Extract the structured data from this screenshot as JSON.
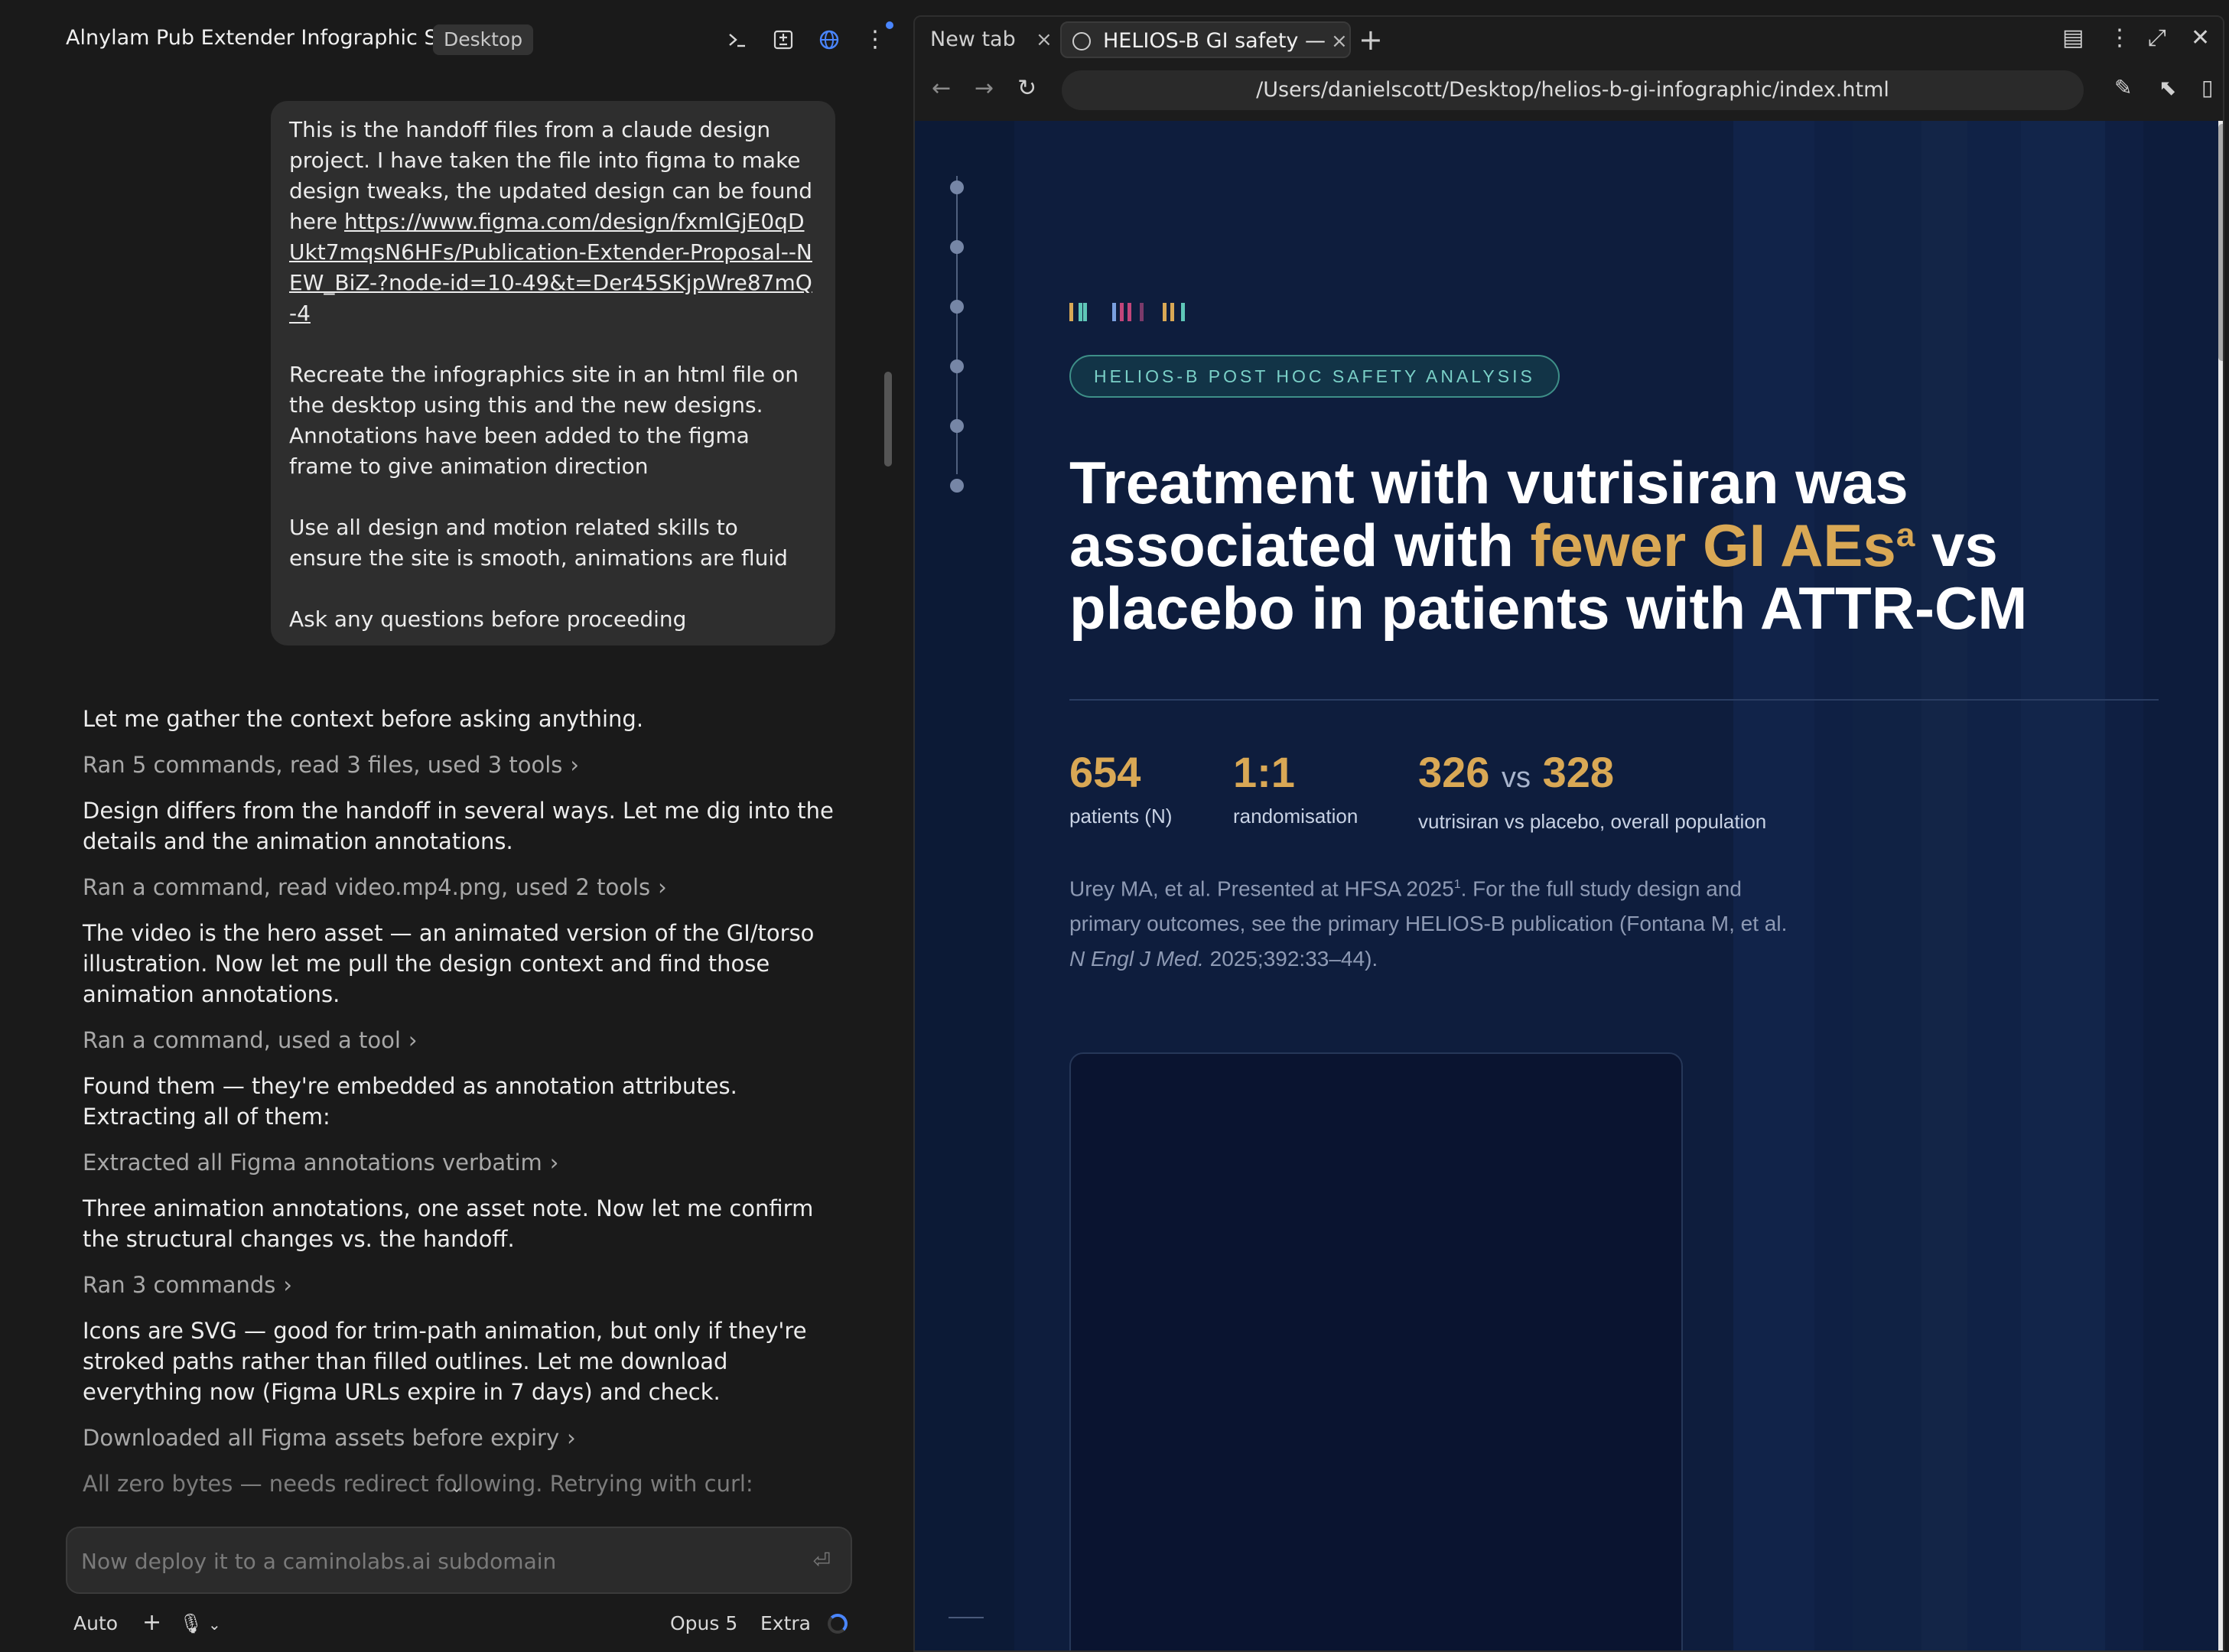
{
  "chat": {
    "title": "Alnylam Pub Extender Infographic Site",
    "badge": "Desktop",
    "user_message": {
      "p1": "This is the handoff files from a claude design project. I have taken the file into figma to make design tweaks, the updated design can be found here",
      "link": "https://www.figma.com/design/fxmlGjE0qDUkt7mqsN6HFs/Publication-Extender-Proposal--NEW_BiZ-?node-id=10-49&t=Der45SKjpWre87mQ-4",
      "p2": "Recreate the infographics site in an html file on the desktop using this and the new designs. Annotations have been added to the figma frame to give animation direction",
      "p3": "Use all design and motion related skills to ensure the site is smooth, animations are fluid",
      "p4": "Ask any questions before proceeding"
    },
    "transcript": [
      {
        "kind": "text",
        "text": "Let me gather the context before asking anything."
      },
      {
        "kind": "tool",
        "text": "Ran 5 commands, read 3 files, used 3 tools"
      },
      {
        "kind": "text",
        "text": "Design differs from the handoff in several ways. Let me dig into the details and the animation annotations."
      },
      {
        "kind": "tool",
        "text": "Ran a command, read video.mp4.png, used 2 tools"
      },
      {
        "kind": "text",
        "text": "The video is the hero asset — an animated version of the GI/torso illustration. Now let me pull the design context and find those animation annotations."
      },
      {
        "kind": "tool",
        "text": "Ran a command, used a tool"
      },
      {
        "kind": "text",
        "text": "Found them — they're embedded as annotation attributes. Extracting all of them:"
      },
      {
        "kind": "tool",
        "text": "Extracted all Figma annotations verbatim"
      },
      {
        "kind": "text",
        "text": "Three animation annotations, one asset note. Now let me confirm the structural changes vs. the handoff."
      },
      {
        "kind": "tool",
        "text": "Ran 3 commands"
      },
      {
        "kind": "text",
        "text": "Icons are SVG — good for trim-path animation, but only if they're stroked paths rather than filled outlines. Let me download everything now (Figma URLs expire in 7 days) and check."
      },
      {
        "kind": "tool",
        "text": "Downloaded all Figma assets before expiry"
      }
    ],
    "faded_line": "All zero bytes — needs redirect following. Retrying with curl:",
    "composer_placeholder": "Now deploy it to a caminolabs.ai subdomain",
    "footer": {
      "mode": "Auto",
      "model": "Opus 5",
      "effort": "Extra"
    }
  },
  "browser": {
    "tabs": [
      {
        "label": "New tab"
      },
      {
        "label": "HELIOS-B GI safety — V"
      }
    ],
    "url": "/Users/danielscott/Desktop/helios-b-gi-infographic/index.html"
  },
  "page": {
    "eyebrow": "HELIOS-B POST HOC SAFETY ANALYSIS",
    "headline": {
      "part1": "Treatment with vutrisiran was associated with ",
      "highlight": "fewer GI AEs",
      "sup": "a",
      "part2": " vs placebo in patients with ATTR-CM"
    },
    "stats": [
      {
        "value": "654",
        "label": "patients (N)"
      },
      {
        "value": "1:1",
        "label": "randomisation"
      },
      {
        "value_a": "326",
        "vs": "vs",
        "value_b": "328",
        "label": "vutrisiran vs placebo, overall population"
      }
    ],
    "citation": {
      "pre": "Urey MA, et al. Presented at HFSA 2025",
      "sup": "1",
      "mid": ". For the full study design and primary outcomes, see the primary HELIOS-B publication (Fontana M, et al. ",
      "journal": "N Engl J Med.",
      "post": " 2025;392:33–44)."
    },
    "colors": {
      "background": "#0e1d3d",
      "accent_gold": "#d9a855",
      "accent_teal": "#7ad0c7"
    }
  }
}
